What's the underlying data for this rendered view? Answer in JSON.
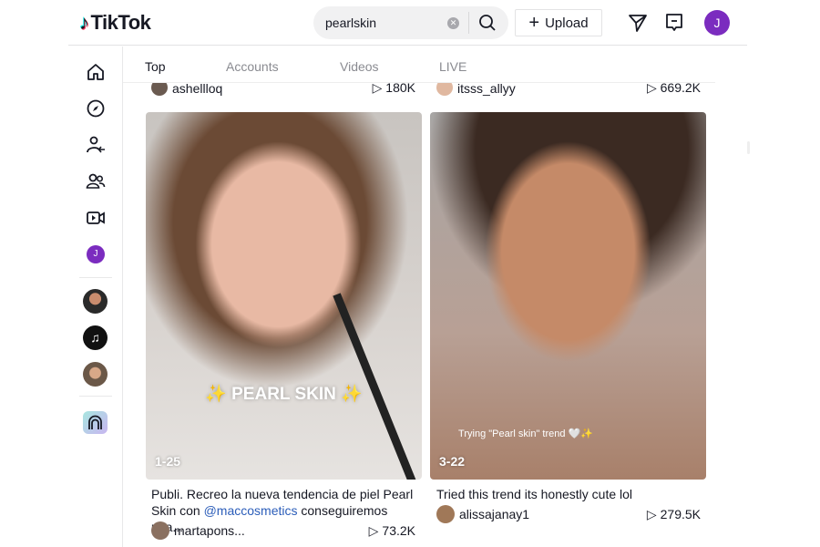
{
  "header": {
    "logo": "TikTok",
    "search_value": "pearlskin",
    "upload_label": "Upload",
    "avatar_initial": "J"
  },
  "sidebar": {
    "items": [
      {
        "name": "home"
      },
      {
        "name": "explore"
      },
      {
        "name": "following"
      },
      {
        "name": "friends"
      },
      {
        "name": "live"
      },
      {
        "name": "profile",
        "initial": "J"
      }
    ]
  },
  "tabs": [
    {
      "label": "Top",
      "active": true
    },
    {
      "label": "Accounts"
    },
    {
      "label": "Videos"
    },
    {
      "label": "LIVE"
    }
  ],
  "partial_row": [
    {
      "user": "ashellloq",
      "views": "180K"
    },
    {
      "user": "itsss_allyy",
      "views": "669.2K"
    }
  ],
  "videos": [
    {
      "date": "1-25",
      "overlay": "✨ PEARL SKIN ✨",
      "desc_before": "Publi. Recreo la nueva tendencia de piel Pearl Skin con ",
      "mention": "@maccosmetics",
      "desc_after": " conseguiremos una...",
      "user": "martapons...",
      "views": "73.2K"
    },
    {
      "date": "3-22",
      "overlay": "Trying \"Pearl skin\" trend 🤍✨",
      "desc": "Tried this trend its honestly cute lol",
      "user": "alissajanay1",
      "views": "279.5K"
    }
  ],
  "colors": {
    "accent": "#fe2c55",
    "avatar": "#7b2cbf",
    "mention": "#2b5db9"
  }
}
